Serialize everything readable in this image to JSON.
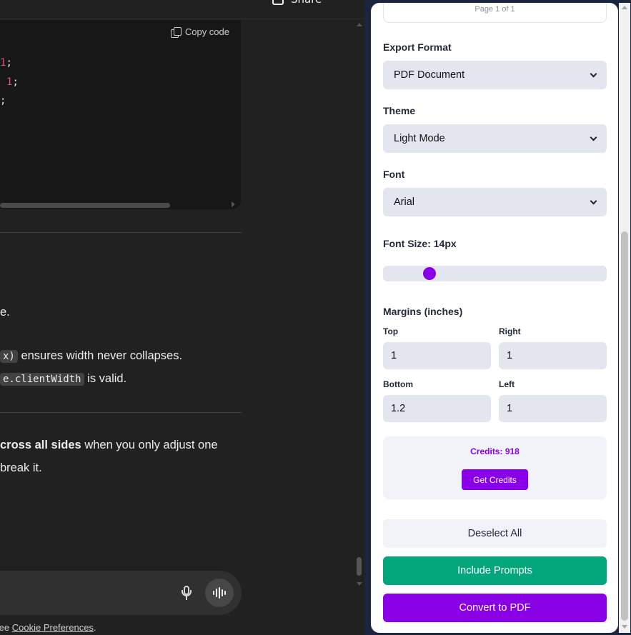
{
  "chat": {
    "share_label": "Share",
    "code_block": {
      "copy_label": "Copy code",
      "lines": [
        {
          "num": "1",
          "tail": ";"
        },
        {
          "num": "1",
          "tail": ";"
        },
        {
          "num": "",
          "tail": ";"
        }
      ]
    },
    "paragraphs": {
      "p1": "e.",
      "p2_code": "x)",
      "p2_text": " ensures width never collapses.",
      "p3_code": "e.clientWidth",
      "p3_text": " is valid.",
      "p4_bold": "cross all sides",
      "p4_text": " when you only adjust one",
      "p5": "break it."
    },
    "footer": {
      "prefix": "See ",
      "link": "Cookie Preferences",
      "suffix": "."
    }
  },
  "panel": {
    "page_indicator": "Page 1 of 1",
    "export_format": {
      "label": "Export Format",
      "value": "PDF Document"
    },
    "theme": {
      "label": "Theme",
      "value": "Light Mode"
    },
    "font": {
      "label": "Font",
      "value": "Arial"
    },
    "font_size": {
      "label": "Font Size: 14px",
      "value": 14
    },
    "margins": {
      "label": "Margins (inches)",
      "top": {
        "label": "Top",
        "value": "1"
      },
      "right": {
        "label": "Right",
        "value": "1"
      },
      "bottom": {
        "label": "Bottom",
        "value": "1.2"
      },
      "left": {
        "label": "Left",
        "value": "1"
      }
    },
    "credits": {
      "text": "Credits: 918",
      "button": "Get Credits"
    },
    "buttons": {
      "deselect": "Deselect All",
      "include": "Include Prompts",
      "convert": "Convert to PDF"
    },
    "colors": {
      "accent": "#8a00e6",
      "green": "#04a77b",
      "field": "#e3e6ef"
    }
  }
}
